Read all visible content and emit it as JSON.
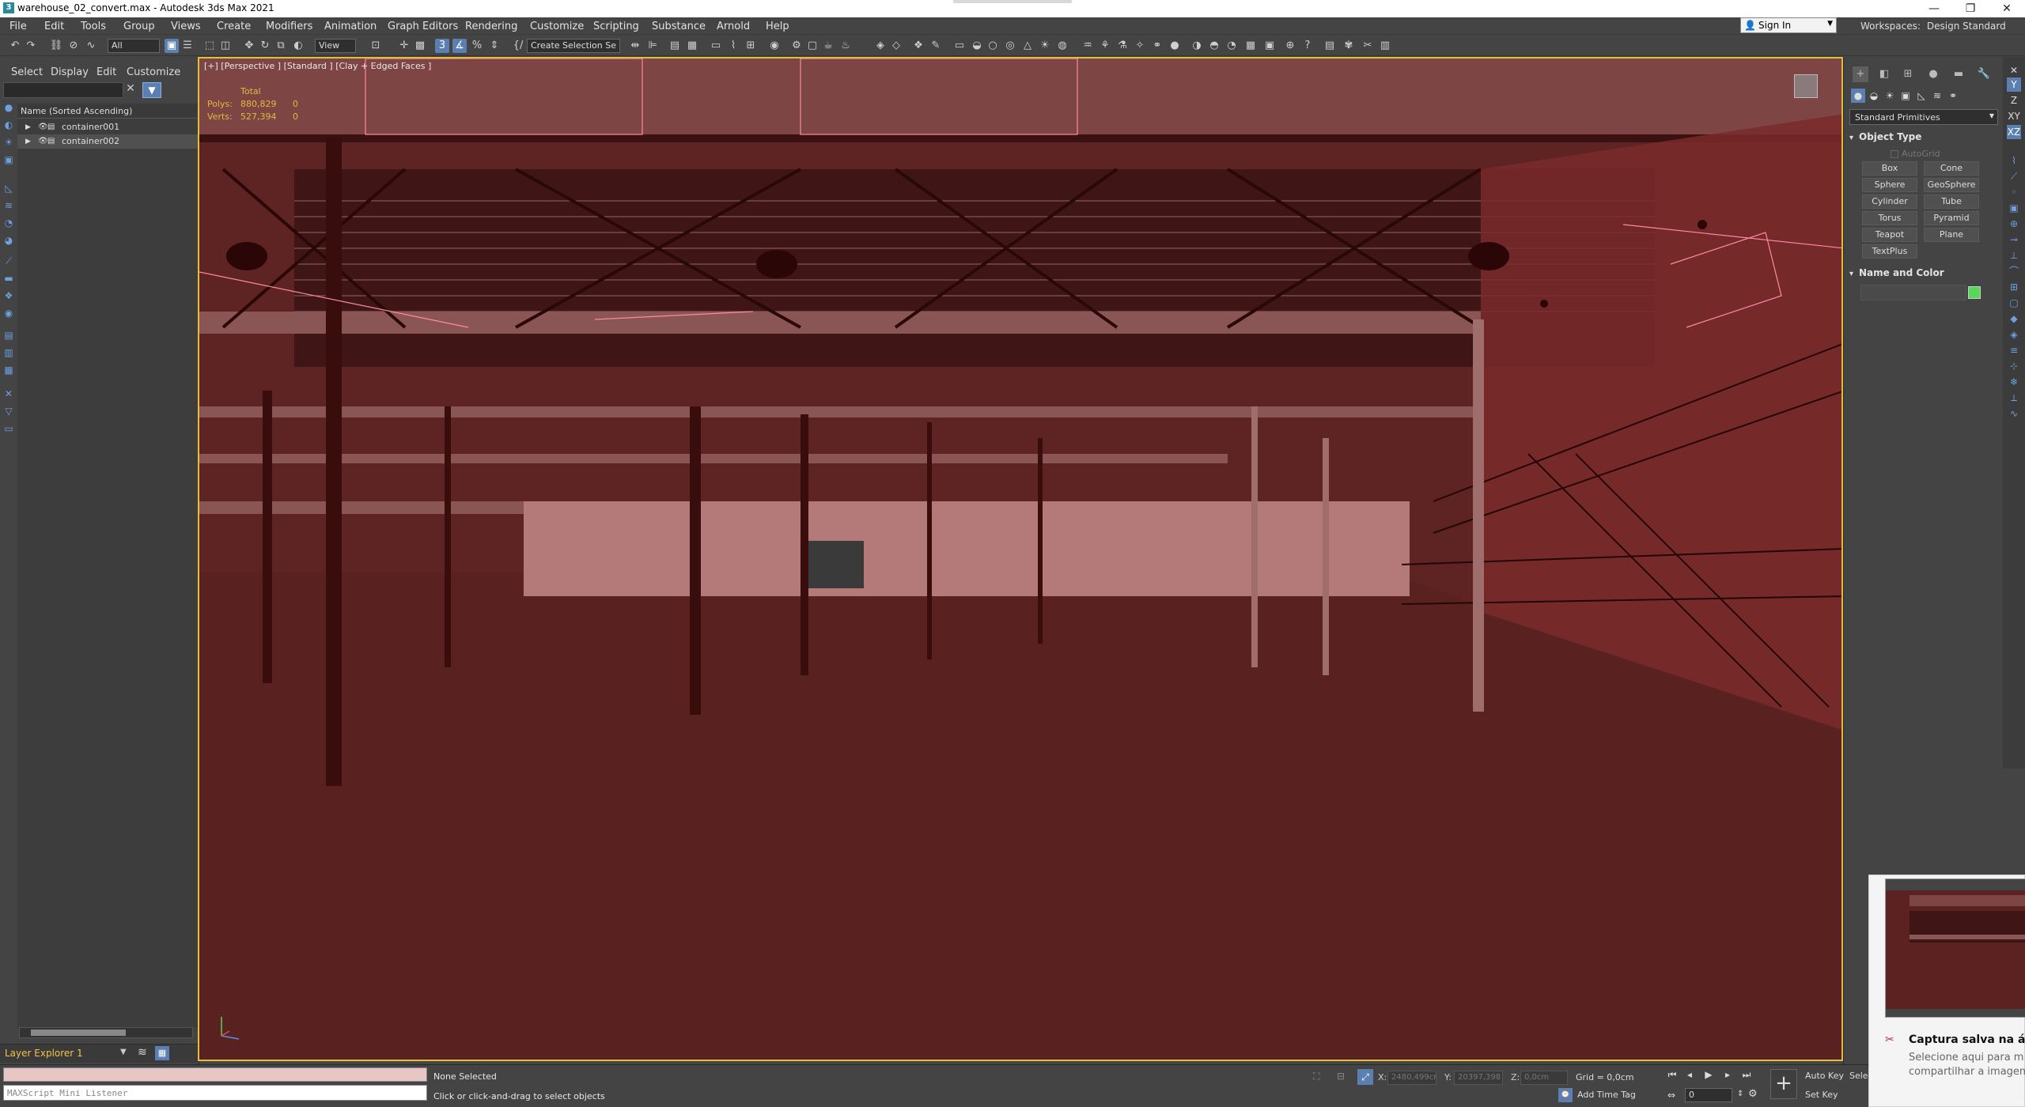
{
  "window": {
    "title": "warehouse_02_convert.max - Autodesk 3ds Max 2021",
    "app_icon_letter": "3",
    "controls": [
      "—",
      "❐",
      "✕"
    ]
  },
  "menu": [
    "File",
    "Edit",
    "Tools",
    "Group",
    "Views",
    "Create",
    "Modifiers",
    "Animation",
    "Graph Editors",
    "Rendering",
    "Customize",
    "Scripting",
    "Substance",
    "Arnold",
    "Help"
  ],
  "account": {
    "sign_in": "Sign In",
    "workspaces_label": "Workspaces:",
    "workspace_value": "Design Standard"
  },
  "toolbar": {
    "filter_dropdown": "All",
    "ref_coord_dropdown": "View",
    "selection_set_dropdown": "Create Selection Se"
  },
  "scene_explorer": {
    "tabs": [
      "Select",
      "Display",
      "Edit",
      "Customize"
    ],
    "column_header": "Name (Sorted Ascending)",
    "items": [
      {
        "name": "container001"
      },
      {
        "name": "container002"
      }
    ],
    "layer_explorer": "Layer Explorer 1"
  },
  "viewport": {
    "label": "[+] [Perspective ] [Standard ] [Clay + Edged Faces ]",
    "stats": {
      "total_label": "Total",
      "polys_label": "Polys:",
      "polys_total": "880,829",
      "polys_sel": "0",
      "verts_label": "Verts:",
      "verts_total": "527,394",
      "verts_sel": "0"
    }
  },
  "command_panel": {
    "category": "Standard Primitives",
    "object_type_header": "Object Type",
    "autogrid": "AutoGrid",
    "primitives": [
      "Box",
      "Cone",
      "Sphere",
      "GeoSphere",
      "Cylinder",
      "Tube",
      "Torus",
      "Pyramid",
      "Teapot",
      "Plane",
      "TextPlus"
    ],
    "name_color_header": "Name and Color",
    "object_color": "#56d85a"
  },
  "status": {
    "maxscript_placeholder": "MAXScript Mini Listener",
    "selection": "None Selected",
    "prompt": "Click or click-and-drag to select objects",
    "x_label": "X:",
    "x_value": "2480,499cr",
    "y_label": "Y:",
    "y_value": "20397,398",
    "z_label": "Z:",
    "z_value": "0,0cm",
    "grid": "Grid = 0,0cm",
    "add_time_tag": "Add Time Tag",
    "frame": "0",
    "auto_key": "Auto Key",
    "set_key": "Set Key",
    "selected_trunc": "Selec"
  },
  "notification": {
    "title": "Captura salva na área",
    "body_line1": "Selecione aqui para m",
    "body_line2": "compartilhar a imagem"
  }
}
